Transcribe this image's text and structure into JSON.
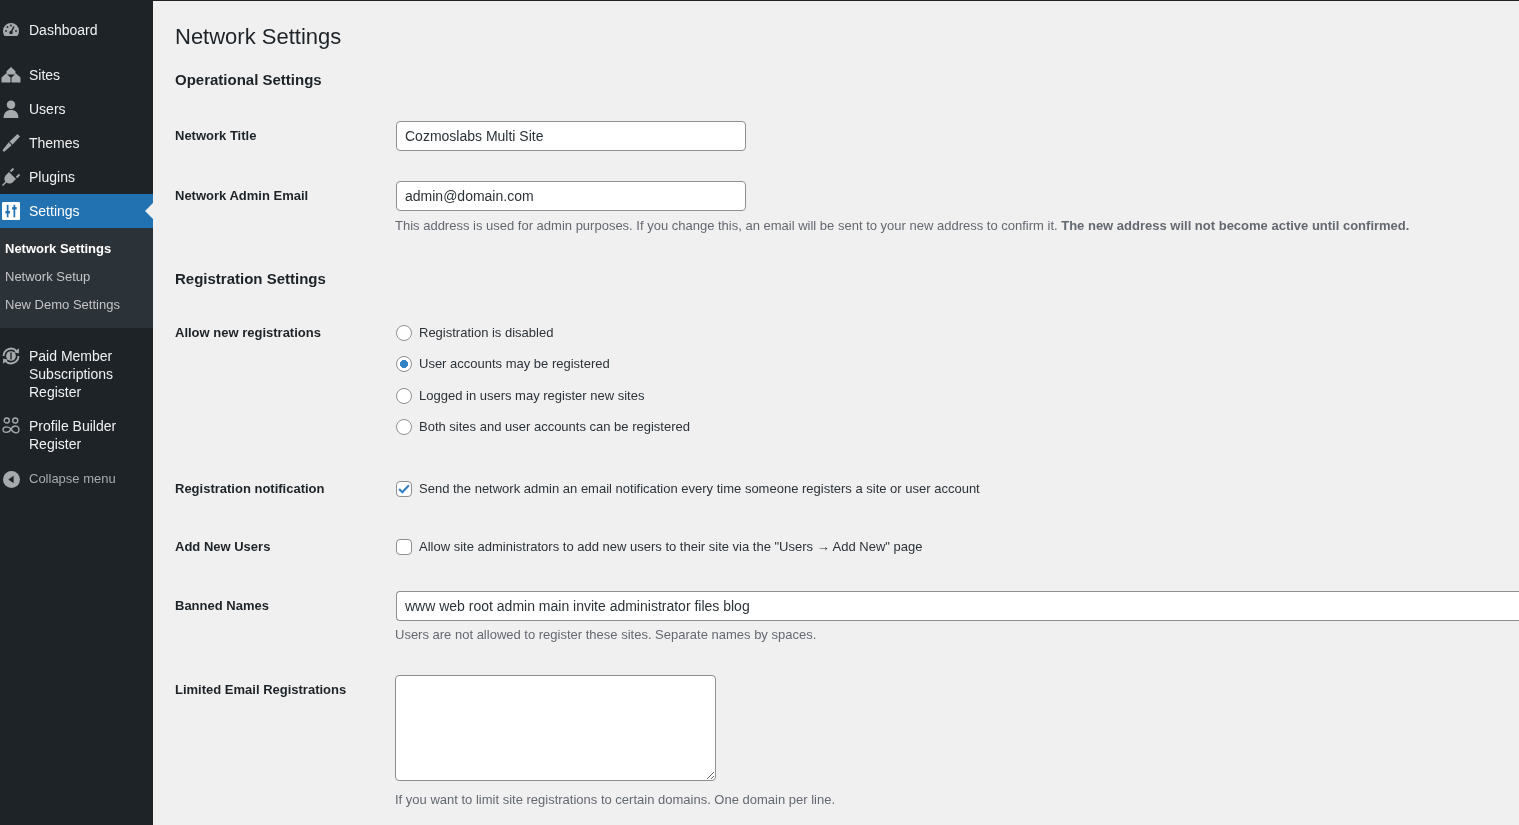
{
  "sidebar": {
    "menu": [
      {
        "label": "Dashboard",
        "selected": false
      },
      {
        "label": "Sites",
        "selected": false
      },
      {
        "label": "Users",
        "selected": false
      },
      {
        "label": "Themes",
        "selected": false
      },
      {
        "label": "Plugins",
        "selected": false
      },
      {
        "label": "Settings",
        "selected": true,
        "submenu": [
          {
            "label": "Network Settings",
            "selected": true
          },
          {
            "label": "Network Setup",
            "selected": false
          },
          {
            "label": "New Demo Settings",
            "selected": false
          }
        ]
      },
      {
        "label": "Paid Member Subscriptions Register",
        "selected": false
      },
      {
        "label": "Profile Builder Register",
        "selected": false
      }
    ],
    "collapse_menu": {
      "label": "Collapse menu"
    }
  },
  "page_title": "Network Settings",
  "sections": [
    {
      "heading": "Operational Settings",
      "fields": [
        {
          "kind": "text",
          "label": "Network Title",
          "value": "Cozmoslabs Multi Site"
        },
        {
          "kind": "text",
          "label": "Network Admin Email",
          "value": "admin@domain.com",
          "description": "This address is used for admin purposes. If you change this, an email will be sent to your new address to confirm it. **The new address will not become active until confirmed.**"
        }
      ]
    },
    {
      "heading": "Registration Settings",
      "fields": [
        {
          "kind": "radio",
          "label": "Allow new registrations",
          "options": [
            {
              "label": "Registration is disabled",
              "selected": false
            },
            {
              "label": "User accounts may be registered",
              "selected": true
            },
            {
              "label": "Logged in users may register new sites",
              "selected": false
            },
            {
              "label": "Both sites and user accounts can be registered",
              "selected": false
            }
          ]
        },
        {
          "kind": "checkbox",
          "label": "Registration notification",
          "text": "Send the network admin an email notification every time someone registers a site or user account",
          "checked": true
        },
        {
          "kind": "checkbox",
          "label": "Add New Users",
          "text": "Allow site administrators to add new users to their site via the \"Users → Add New\" page",
          "checked": false
        },
        {
          "kind": "wide-text",
          "label": "Banned Names",
          "value": "www web root admin main invite administrator files blog",
          "description": "Users are not allowed to register these sites. Separate names by spaces."
        },
        {
          "kind": "textarea",
          "label": "Limited Email Registrations",
          "description": "If you want to limit site registrations to certain domains. One domain per line."
        }
      ]
    }
  ]
}
